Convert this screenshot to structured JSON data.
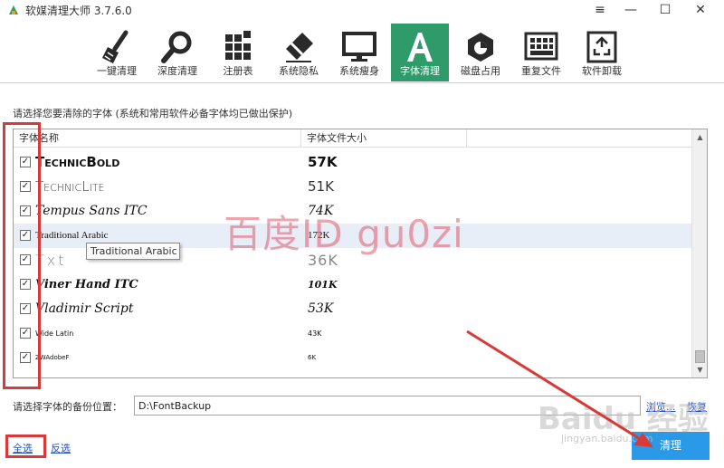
{
  "window": {
    "title": "软媒清理大师 3.7.6.0",
    "controls": {
      "menu": "≡",
      "minimize": "—",
      "maximize": "☐",
      "close": "✕"
    }
  },
  "toolbar": {
    "active_color": "#2f9a6a",
    "items": [
      {
        "label": "一键清理",
        "icon": "broom-icon"
      },
      {
        "label": "深度清理",
        "icon": "magnifier-icon"
      },
      {
        "label": "注册表",
        "icon": "registry-blocks-icon"
      },
      {
        "label": "系统隐私",
        "icon": "eraser-icon"
      },
      {
        "label": "系统瘦身",
        "icon": "monitor-icon"
      },
      {
        "label": "字体清理",
        "icon": "font-a-icon",
        "active": true
      },
      {
        "label": "磁盘占用",
        "icon": "disk-icon"
      },
      {
        "label": "重复文件",
        "icon": "duplicate-grid-icon"
      },
      {
        "label": "软件卸载",
        "icon": "recycle-icon"
      }
    ]
  },
  "instruction": "请选择您要清除的字体 (系统和常用软件必备字体均已做出保护)",
  "table": {
    "columns": [
      "字体名称",
      "字体文件大小"
    ],
    "rows": [
      {
        "checked": true,
        "name": "TechnicBold",
        "size": "57K"
      },
      {
        "checked": true,
        "name": "TechnicLite",
        "size": "51K"
      },
      {
        "checked": true,
        "name": "Tempus Sans ITC",
        "size": "74K"
      },
      {
        "checked": true,
        "name": "Traditional Arabic",
        "size": "172K"
      },
      {
        "checked": true,
        "name": "Txt",
        "size": "36K"
      },
      {
        "checked": true,
        "name": "Viner Hand ITC",
        "size": "101K"
      },
      {
        "checked": true,
        "name": "Vladimir Script",
        "size": "53K"
      },
      {
        "checked": true,
        "name": "Wide Latin",
        "size": "43K"
      },
      {
        "checked": true,
        "name": "ZWAdobeF",
        "size": "6K"
      }
    ],
    "tooltip": "Traditional Arabic"
  },
  "backup": {
    "label": "请选择字体的备份位置：",
    "path": "D:\\FontBackup",
    "browse": "浏览...",
    "restore": "恢复"
  },
  "footer": {
    "select_all": "全选",
    "invert": "反选",
    "clean": "清理"
  },
  "watermark": {
    "text": "百度ID gu0zi",
    "baidu": "Baidu 经验",
    "url": "jingyan.baidu.com"
  },
  "colors": {
    "annotation": "#d83a3a",
    "clean_button": "#2a9ae8",
    "link": "#1f4fbf"
  }
}
